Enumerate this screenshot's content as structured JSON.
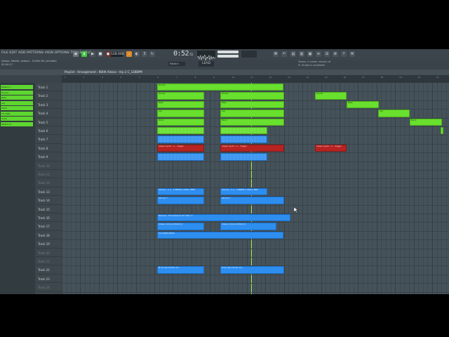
{
  "menu": {
    "label": "FILE EDIT ADD PATTERNS VIEW OPTIONS TOOLS HELP"
  },
  "song": {
    "line1": "Alesso, Mobile, Adison - A little Bit (remake)",
    "line2": "42:00:17"
  },
  "transport": {
    "tempo": "128.000",
    "time_main": "0:52",
    "time_sub": ":51",
    "pattern": "Pattern",
    "lead": "LEAD"
  },
  "hint": {
    "line1": "Tomez: A newer version of",
    "line2": "FL Studio is available!"
  },
  "playlist": {
    "title": "Playlist - Arrangement › 98HA Alesso - Arp 2 C_128BPM"
  },
  "ruler": [
    "1",
    "2",
    "3",
    "4",
    "5",
    "6",
    "7",
    "8",
    "9",
    "10",
    "11",
    "12",
    "13",
    "14",
    "15",
    "16",
    "17",
    "18",
    "19",
    "20",
    "21"
  ],
  "browser_patterns": [
    "Pattern 1",
    "Drums",
    "Bass",
    "Arp",
    "Pluck",
    "FX 1308",
    "Vocal",
    "Pattern 8"
  ],
  "tracks": [
    {
      "label": "Track 1",
      "dim": false
    },
    {
      "label": "Track 2",
      "dim": false
    },
    {
      "label": "Track 3",
      "dim": false
    },
    {
      "label": "Track 4",
      "dim": false
    },
    {
      "label": "Track 5",
      "dim": false
    },
    {
      "label": "Track 6",
      "dim": false
    },
    {
      "label": "Track 7",
      "dim": false
    },
    {
      "label": "Track 8",
      "dim": false
    },
    {
      "label": "Track 9",
      "dim": false
    },
    {
      "label": "Track 10",
      "dim": true
    },
    {
      "label": "Track 11",
      "dim": true
    },
    {
      "label": "Track 12",
      "dim": true
    },
    {
      "label": "Track 13",
      "dim": false
    },
    {
      "label": "Track 14",
      "dim": false
    },
    {
      "label": "Track 15",
      "dim": false
    },
    {
      "label": "Track 16",
      "dim": false
    },
    {
      "label": "Track 17",
      "dim": false
    },
    {
      "label": "Track 18",
      "dim": false
    },
    {
      "label": "Track 19",
      "dim": false
    },
    {
      "label": "Track 20",
      "dim": true
    },
    {
      "label": "Track 21",
      "dim": true
    },
    {
      "label": "Track 22",
      "dim": false
    },
    {
      "label": "Track 23",
      "dim": false
    },
    {
      "label": "Track 24",
      "dim": true
    }
  ],
  "clip_labels": {
    "drums": "Drums",
    "bass": "Bass",
    "arp": "Arp",
    "pluck": "Pluck",
    "trigger": "Alesso Synth..r 1 - Trigger",
    "shouse": "Shouse - C_2 - 128BPM ▸ Glitter..BPM",
    "lofi": "lofi Arp 7",
    "reverse": "Reverse - FS Ambience 07 (128, 7)",
    "vocal": "Alesso_Vocal_Ambient_4",
    "fxdown": "FX DOWN DROP",
    "clip23": "Bl 15 des 19-Dec-19..."
  },
  "colors": {
    "green": "#69df2e",
    "red": "#b72321",
    "blue": "#2d8ef0",
    "playhead": "#a7f44f"
  }
}
